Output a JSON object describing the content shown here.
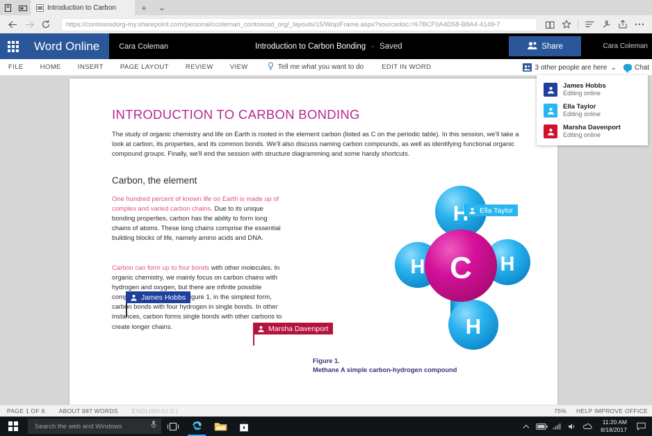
{
  "browser": {
    "tab_title": "Introduction to Carbon",
    "url": "https://contososdorg-my.sharepoint.com/personal/ccoleman_contososd_org/_layouts/15/WopiFrame.aspx?sourcedoc=%7BCF0A4D58-B8A4-4149-7",
    "new_tab_label": "+",
    "tab_menu_label": "⌄",
    "icons": {
      "back": "back-arrow-icon",
      "forward": "forward-arrow-icon",
      "refresh": "refresh-icon",
      "reading_view": "reading-view-icon",
      "favorites": "star-icon",
      "hub": "hub-icon",
      "web_note": "web-note-pen-icon",
      "share": "share-icon",
      "more": "more-ellipsis-icon"
    }
  },
  "header": {
    "app_name": "Word Online",
    "account_name_left": "Cara Coleman",
    "doc_title": "Introduction to Carbon Bonding",
    "separator": "-",
    "save_state": "Saved",
    "share_label": "Share",
    "account_name_right": "Cara Coleman"
  },
  "ribbon": {
    "tabs": [
      "FILE",
      "HOME",
      "INSERT",
      "PAGE LAYOUT",
      "REVIEW",
      "VIEW"
    ],
    "tell_me": "Tell me what you want to do",
    "edit_in_word": "EDIT IN WORD",
    "people_here": "3 other people are here",
    "people_here_caret": "⌄",
    "chat_label": "Chat"
  },
  "people_panel": {
    "people": [
      {
        "name": "James Hobbs",
        "status": "Editing online",
        "color": "#1f3f9e"
      },
      {
        "name": "Ella Taylor",
        "status": "Editing online",
        "color": "#29b6f0"
      },
      {
        "name": "Marsha Davenport",
        "status": "Editing online",
        "color": "#b5123e"
      }
    ]
  },
  "document": {
    "heading": "INTRODUCTION TO CARBON BONDING",
    "paragraph_1": "The study of organic chemistry and life on Earth is rooted in the element carbon (listed as C on the periodic table). In this session, we'll take a look at carbon, its properties, and its common bonds. We'll also discuss naming carbon compounds, as well as identifying functional organic compound groups. Finally, we'll end the session with structure diagramming and some handy shortcuts.",
    "subheading": "Carbon, the element",
    "paragraph_2_red": "One hundred percent of known life on Earth is made up of complex and varied carbon chains.",
    "paragraph_2_rest": " Due to its unique bonding properties, carbon has the ability to form long chains of atoms. These long chains comprise the essential building blocks of life, namely amino acids and DNA.",
    "paragraph_3_red": "Carbon can form up to four bonds",
    "paragraph_3_rest": " with other molecules. In organic chemistry, we mainly focus on carbon chains with hydrogen and oxygen, but there are infinite possible compounds. As shown in Figure 1, in the simplest form, carbon bonds with four hydrogen in single bonds.  In other instances, carbon forms single bonds with other carbons to create longer chains.",
    "figure_label": "Figure 1.",
    "figure_caption": "Methane A simple carbon-hydrogen compound",
    "molecule": {
      "center_atom": "C",
      "outer_atoms": [
        "H",
        "H",
        "H",
        "H"
      ],
      "carbon_color": "#cc0d8c",
      "hydrogen_color": "#1fa9e8"
    }
  },
  "collaborators": [
    {
      "name": "Ella Taylor",
      "color": "#29b6f0"
    },
    {
      "name": "James Hobbs",
      "color": "#1f3f9e"
    },
    {
      "name": "Marsha Davenport",
      "color": "#b5123e"
    }
  ],
  "status_bar": {
    "page": "PAGE 1 OF 6",
    "words": "ABOUT 987 WORDS",
    "language": "ENGLISH (U.S.)",
    "zoom": "75%",
    "help": "HELP IMPROVE OFFICE"
  },
  "taskbar": {
    "search_placeholder": "Search the web and Windows",
    "time": "11:20 AM",
    "date": "8/18/2017",
    "icons": {
      "start": "windows-start-icon",
      "mic": "microphone-icon",
      "task_view": "task-view-icon",
      "edge": "edge-browser-icon",
      "explorer": "file-explorer-icon",
      "store": "store-icon",
      "show_hidden": "show-hidden-icons-chevron",
      "battery": "battery-icon",
      "network": "network-icon",
      "volume": "volume-icon",
      "onedrive": "onedrive-sync-icon",
      "action_center": "action-center-icon"
    }
  }
}
